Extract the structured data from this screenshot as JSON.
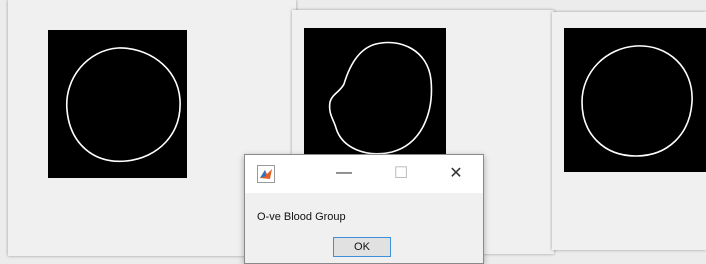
{
  "figures": [
    {
      "id": "figure-1",
      "image": "white irregular circular cell outline on black background"
    },
    {
      "id": "figure-2",
      "image": "white irregular rounded cell outline with indent on black background"
    },
    {
      "id": "figure-3",
      "image": "white circular cell outline on black background"
    }
  ],
  "dialog": {
    "app_icon": "matlab-icon",
    "minimize_glyph": "—",
    "maximize_glyph": "☐",
    "close_glyph": "✕",
    "message": "O-ve Blood Group",
    "ok_label": "OK"
  },
  "colors": {
    "image_background": "#000000",
    "outline": "#ffffff",
    "ok_button_border": "#3c8fd8"
  }
}
